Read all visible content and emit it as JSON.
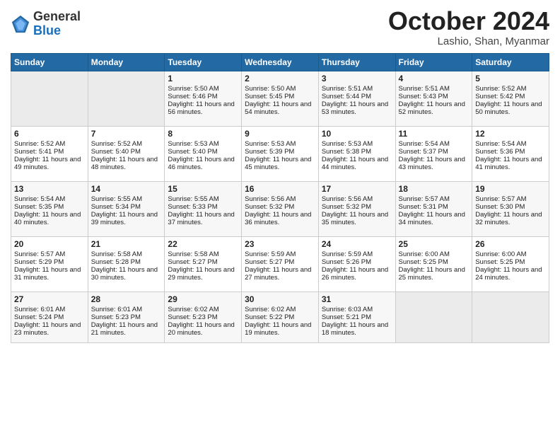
{
  "logo": {
    "general": "General",
    "blue": "Blue"
  },
  "title": "October 2024",
  "location": "Lashio, Shan, Myanmar",
  "headers": [
    "Sunday",
    "Monday",
    "Tuesday",
    "Wednesday",
    "Thursday",
    "Friday",
    "Saturday"
  ],
  "weeks": [
    [
      {
        "day": "",
        "sunrise": "",
        "sunset": "",
        "daylight": ""
      },
      {
        "day": "",
        "sunrise": "",
        "sunset": "",
        "daylight": ""
      },
      {
        "day": "1",
        "sunrise": "Sunrise: 5:50 AM",
        "sunset": "Sunset: 5:46 PM",
        "daylight": "Daylight: 11 hours and 56 minutes."
      },
      {
        "day": "2",
        "sunrise": "Sunrise: 5:50 AM",
        "sunset": "Sunset: 5:45 PM",
        "daylight": "Daylight: 11 hours and 54 minutes."
      },
      {
        "day": "3",
        "sunrise": "Sunrise: 5:51 AM",
        "sunset": "Sunset: 5:44 PM",
        "daylight": "Daylight: 11 hours and 53 minutes."
      },
      {
        "day": "4",
        "sunrise": "Sunrise: 5:51 AM",
        "sunset": "Sunset: 5:43 PM",
        "daylight": "Daylight: 11 hours and 52 minutes."
      },
      {
        "day": "5",
        "sunrise": "Sunrise: 5:52 AM",
        "sunset": "Sunset: 5:42 PM",
        "daylight": "Daylight: 11 hours and 50 minutes."
      }
    ],
    [
      {
        "day": "6",
        "sunrise": "Sunrise: 5:52 AM",
        "sunset": "Sunset: 5:41 PM",
        "daylight": "Daylight: 11 hours and 49 minutes."
      },
      {
        "day": "7",
        "sunrise": "Sunrise: 5:52 AM",
        "sunset": "Sunset: 5:40 PM",
        "daylight": "Daylight: 11 hours and 48 minutes."
      },
      {
        "day": "8",
        "sunrise": "Sunrise: 5:53 AM",
        "sunset": "Sunset: 5:40 PM",
        "daylight": "Daylight: 11 hours and 46 minutes."
      },
      {
        "day": "9",
        "sunrise": "Sunrise: 5:53 AM",
        "sunset": "Sunset: 5:39 PM",
        "daylight": "Daylight: 11 hours and 45 minutes."
      },
      {
        "day": "10",
        "sunrise": "Sunrise: 5:53 AM",
        "sunset": "Sunset: 5:38 PM",
        "daylight": "Daylight: 11 hours and 44 minutes."
      },
      {
        "day": "11",
        "sunrise": "Sunrise: 5:54 AM",
        "sunset": "Sunset: 5:37 PM",
        "daylight": "Daylight: 11 hours and 43 minutes."
      },
      {
        "day": "12",
        "sunrise": "Sunrise: 5:54 AM",
        "sunset": "Sunset: 5:36 PM",
        "daylight": "Daylight: 11 hours and 41 minutes."
      }
    ],
    [
      {
        "day": "13",
        "sunrise": "Sunrise: 5:54 AM",
        "sunset": "Sunset: 5:35 PM",
        "daylight": "Daylight: 11 hours and 40 minutes."
      },
      {
        "day": "14",
        "sunrise": "Sunrise: 5:55 AM",
        "sunset": "Sunset: 5:34 PM",
        "daylight": "Daylight: 11 hours and 39 minutes."
      },
      {
        "day": "15",
        "sunrise": "Sunrise: 5:55 AM",
        "sunset": "Sunset: 5:33 PM",
        "daylight": "Daylight: 11 hours and 37 minutes."
      },
      {
        "day": "16",
        "sunrise": "Sunrise: 5:56 AM",
        "sunset": "Sunset: 5:32 PM",
        "daylight": "Daylight: 11 hours and 36 minutes."
      },
      {
        "day": "17",
        "sunrise": "Sunrise: 5:56 AM",
        "sunset": "Sunset: 5:32 PM",
        "daylight": "Daylight: 11 hours and 35 minutes."
      },
      {
        "day": "18",
        "sunrise": "Sunrise: 5:57 AM",
        "sunset": "Sunset: 5:31 PM",
        "daylight": "Daylight: 11 hours and 34 minutes."
      },
      {
        "day": "19",
        "sunrise": "Sunrise: 5:57 AM",
        "sunset": "Sunset: 5:30 PM",
        "daylight": "Daylight: 11 hours and 32 minutes."
      }
    ],
    [
      {
        "day": "20",
        "sunrise": "Sunrise: 5:57 AM",
        "sunset": "Sunset: 5:29 PM",
        "daylight": "Daylight: 11 hours and 31 minutes."
      },
      {
        "day": "21",
        "sunrise": "Sunrise: 5:58 AM",
        "sunset": "Sunset: 5:28 PM",
        "daylight": "Daylight: 11 hours and 30 minutes."
      },
      {
        "day": "22",
        "sunrise": "Sunrise: 5:58 AM",
        "sunset": "Sunset: 5:27 PM",
        "daylight": "Daylight: 11 hours and 29 minutes."
      },
      {
        "day": "23",
        "sunrise": "Sunrise: 5:59 AM",
        "sunset": "Sunset: 5:27 PM",
        "daylight": "Daylight: 11 hours and 27 minutes."
      },
      {
        "day": "24",
        "sunrise": "Sunrise: 5:59 AM",
        "sunset": "Sunset: 5:26 PM",
        "daylight": "Daylight: 11 hours and 26 minutes."
      },
      {
        "day": "25",
        "sunrise": "Sunrise: 6:00 AM",
        "sunset": "Sunset: 5:25 PM",
        "daylight": "Daylight: 11 hours and 25 minutes."
      },
      {
        "day": "26",
        "sunrise": "Sunrise: 6:00 AM",
        "sunset": "Sunset: 5:25 PM",
        "daylight": "Daylight: 11 hours and 24 minutes."
      }
    ],
    [
      {
        "day": "27",
        "sunrise": "Sunrise: 6:01 AM",
        "sunset": "Sunset: 5:24 PM",
        "daylight": "Daylight: 11 hours and 23 minutes."
      },
      {
        "day": "28",
        "sunrise": "Sunrise: 6:01 AM",
        "sunset": "Sunset: 5:23 PM",
        "daylight": "Daylight: 11 hours and 21 minutes."
      },
      {
        "day": "29",
        "sunrise": "Sunrise: 6:02 AM",
        "sunset": "Sunset: 5:23 PM",
        "daylight": "Daylight: 11 hours and 20 minutes."
      },
      {
        "day": "30",
        "sunrise": "Sunrise: 6:02 AM",
        "sunset": "Sunset: 5:22 PM",
        "daylight": "Daylight: 11 hours and 19 minutes."
      },
      {
        "day": "31",
        "sunrise": "Sunrise: 6:03 AM",
        "sunset": "Sunset: 5:21 PM",
        "daylight": "Daylight: 11 hours and 18 minutes."
      },
      {
        "day": "",
        "sunrise": "",
        "sunset": "",
        "daylight": ""
      },
      {
        "day": "",
        "sunrise": "",
        "sunset": "",
        "daylight": ""
      }
    ]
  ]
}
